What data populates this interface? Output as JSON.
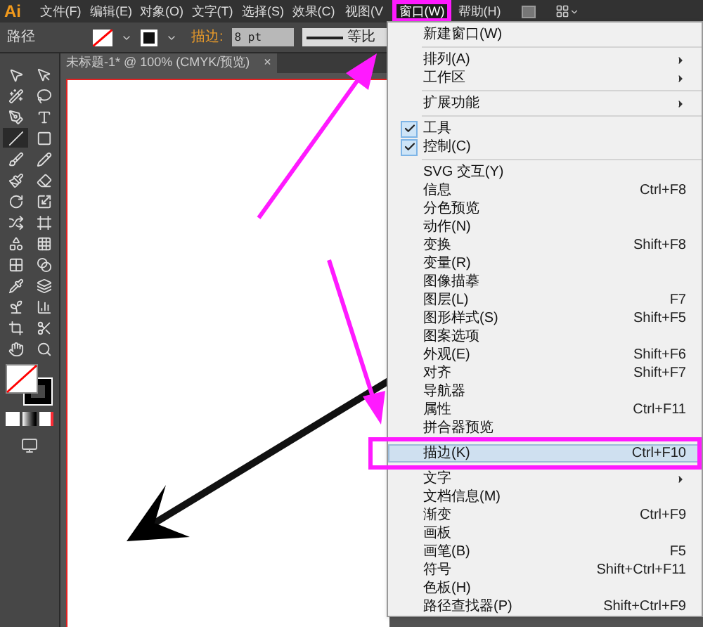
{
  "menu_bar": {
    "logo": "Ai",
    "items": [
      {
        "label": "文件(F)",
        "selected": false
      },
      {
        "label": "编辑(E)",
        "selected": false
      },
      {
        "label": "对象(O)",
        "selected": false
      },
      {
        "label": "文字(T)",
        "selected": false
      },
      {
        "label": "选择(S)",
        "selected": false
      },
      {
        "label": "效果(C)",
        "selected": false
      },
      {
        "label": "视图(V",
        "selected": false
      },
      {
        "label": "窗口(W)",
        "selected": true
      },
      {
        "label": "帮助(H)",
        "selected": false
      }
    ]
  },
  "control_bar": {
    "object_type": "路径",
    "stroke_label": "描边:",
    "stroke_weight": "8 pt",
    "profile": "等比"
  },
  "document_tab": {
    "title": "未标题-1* @ 100% (CMYK/预览)",
    "close": "×"
  },
  "tools": [
    {
      "selected": false
    },
    {
      "selected": false
    },
    {
      "selected": false
    },
    {
      "selected": false
    },
    {
      "selected": false
    },
    {
      "selected": false
    },
    {
      "selected": true
    },
    {
      "selected": false
    },
    {
      "selected": false
    },
    {
      "selected": false
    },
    {
      "selected": false
    },
    {
      "selected": false
    },
    {
      "selected": false
    },
    {
      "selected": false
    },
    {
      "selected": false
    },
    {
      "selected": false
    },
    {
      "selected": false
    },
    {
      "selected": false
    },
    {
      "selected": false
    },
    {
      "selected": false
    },
    {
      "selected": false
    },
    {
      "selected": false
    },
    {
      "selected": false
    },
    {
      "selected": false
    },
    {
      "selected": false
    },
    {
      "selected": false
    },
    {
      "selected": false
    },
    {
      "selected": false
    }
  ],
  "window_menu": [
    {
      "kind": "item",
      "label": "新建窗口(W)",
      "selected": false
    },
    {
      "kind": "separator"
    },
    {
      "kind": "item",
      "label": "排列(A)",
      "submenu": true,
      "selected": false
    },
    {
      "kind": "item",
      "label": "工作区",
      "submenu": true,
      "selected": false
    },
    {
      "kind": "separator"
    },
    {
      "kind": "item",
      "label": "扩展功能",
      "submenu": true,
      "selected": false
    },
    {
      "kind": "separator"
    },
    {
      "kind": "item",
      "label": "工具",
      "checked": true,
      "selected": false
    },
    {
      "kind": "item",
      "label": "控制(C)",
      "checked": true,
      "selected": false
    },
    {
      "kind": "separator"
    },
    {
      "kind": "item",
      "label": "SVG 交互(Y)",
      "selected": false
    },
    {
      "kind": "item",
      "label": "信息",
      "shortcut": "Ctrl+F8",
      "selected": false
    },
    {
      "kind": "item",
      "label": "分色预览",
      "selected": false
    },
    {
      "kind": "item",
      "label": "动作(N)",
      "selected": false
    },
    {
      "kind": "item",
      "label": "变换",
      "shortcut": "Shift+F8",
      "selected": false
    },
    {
      "kind": "item",
      "label": "变量(R)",
      "selected": false
    },
    {
      "kind": "item",
      "label": "图像描摹",
      "selected": false
    },
    {
      "kind": "item",
      "label": "图层(L)",
      "shortcut": "F7",
      "selected": false
    },
    {
      "kind": "item",
      "label": "图形样式(S)",
      "shortcut": "Shift+F5",
      "selected": false
    },
    {
      "kind": "item",
      "label": "图案选项",
      "selected": false
    },
    {
      "kind": "item",
      "label": "外观(E)",
      "shortcut": "Shift+F6",
      "selected": false
    },
    {
      "kind": "item",
      "label": "对齐",
      "shortcut": "Shift+F7",
      "selected": false
    },
    {
      "kind": "item",
      "label": "导航器",
      "selected": false
    },
    {
      "kind": "item",
      "label": "属性",
      "shortcut": "Ctrl+F11",
      "selected": false
    },
    {
      "kind": "item",
      "label": "拼合器预览",
      "selected": false
    },
    {
      "kind": "item",
      "label": "描边(K)",
      "shortcut": "Ctrl+F10",
      "selected": true
    },
    {
      "kind": "item",
      "label": "文字",
      "submenu": true,
      "selected": false
    },
    {
      "kind": "item",
      "label": "文档信息(M)",
      "selected": false
    },
    {
      "kind": "item",
      "label": "渐变",
      "shortcut": "Ctrl+F9",
      "selected": false
    },
    {
      "kind": "item",
      "label": "画板",
      "selected": false
    },
    {
      "kind": "item",
      "label": "画笔(B)",
      "shortcut": "F5",
      "selected": false
    },
    {
      "kind": "item",
      "label": "符号",
      "shortcut": "Shift+Ctrl+F11",
      "selected": false
    },
    {
      "kind": "item",
      "label": "色板(H)",
      "selected": false
    },
    {
      "kind": "item",
      "label": "路径查找器(P)",
      "shortcut": "Shift+Ctrl+F9",
      "selected": false
    }
  ]
}
